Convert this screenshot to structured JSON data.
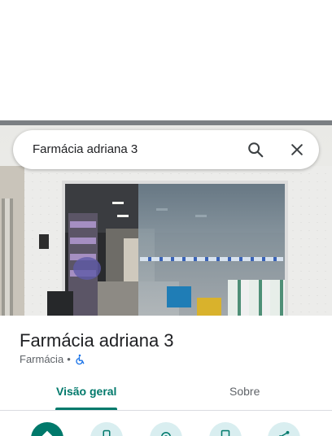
{
  "search": {
    "query": "Farmácia adriana 3",
    "search_icon": "search-icon",
    "close_icon": "close-icon"
  },
  "place": {
    "name": "Farmácia adriana 3",
    "category": "Farmácia",
    "separator": "•",
    "accessibility_icon": "wheelchair-icon",
    "accessibility_color": "#1a73e8"
  },
  "tabs": [
    {
      "label": "Visão geral",
      "selected": true
    },
    {
      "label": "Sobre",
      "selected": false
    }
  ],
  "actions": [
    {
      "icon": "directions-icon",
      "primary": true
    },
    {
      "icon": "phone-icon",
      "primary": false
    },
    {
      "icon": "location-icon",
      "primary": false
    },
    {
      "icon": "bookmark-icon",
      "primary": false
    },
    {
      "icon": "share-icon",
      "primary": false
    }
  ],
  "colors": {
    "accent": "#00796b",
    "action_bg": "#d9eef0",
    "text_primary": "#202124",
    "text_secondary": "#5f6368"
  }
}
